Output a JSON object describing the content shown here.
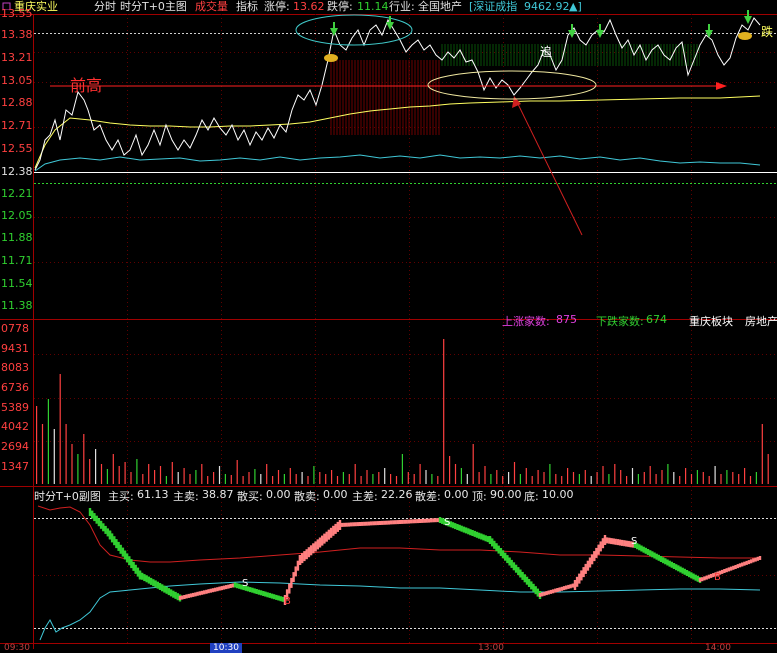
{
  "toolbar": {
    "stock_name": "重庆实业",
    "tab_timeshare": "分时",
    "tab_t0_main": "时分T+0主图",
    "tab_volume": "成交量",
    "tab_indicator": "指标",
    "limit_up_label": "涨停:",
    "limit_up_value": "13.62",
    "limit_down_label": "跌停:",
    "limit_down_value": "11.14",
    "industry_label": "行业:",
    "industry_value": "全国地产",
    "index_label": "[深证成指",
    "index_value": "9462.92",
    "index_arrow": "▲]"
  },
  "price_axis": [
    "13.55",
    "13.38",
    "13.21",
    "13.05",
    "12.88",
    "12.71",
    "12.55",
    "12.38",
    "12.21",
    "12.05",
    "11.88",
    "11.71",
    "11.54",
    "11.38"
  ],
  "volume_axis": [
    "0778",
    "9431",
    "8083",
    "6736",
    "5389",
    "4042",
    "2694",
    "1347"
  ],
  "annotations": {
    "previous_high": "前高",
    "chase": "追",
    "fall": "跌",
    "s_label_1": "S",
    "s_label_2": "S",
    "s_label_3": "S",
    "b_label_1": "B",
    "b_label_2": "B"
  },
  "breadth": {
    "up_label": "上涨家数:",
    "up_value": "875",
    "down_label": "下跌家数:",
    "down_value": "674",
    "sector": "重庆板块",
    "category": "房地产"
  },
  "sub_chart": {
    "title": "时分T+0副图",
    "main_buy_label": "主买:",
    "main_buy_value": "61.13",
    "main_sell_label": "主卖:",
    "main_sell_value": "38.87",
    "retail_buy_label": "散买:",
    "retail_buy_value": "0.00",
    "retail_sell_label": "散卖:",
    "retail_sell_value": "0.00",
    "main_diff_label": "主差:",
    "main_diff_value": "22.26",
    "retail_diff_label": "散差:",
    "retail_diff_value": "0.00",
    "top_label": "顶:",
    "top_value": "90.00",
    "bottom_label": "底:",
    "bottom_value": "10.00"
  },
  "time_axis": {
    "t1": "09:30",
    "t2": "10:30",
    "t3": "13:00",
    "t4": "14:00"
  },
  "colors": {
    "price_line": "#ffffff",
    "avg_line": "#ffff60",
    "index_line": "#40c8d8",
    "up": "#ff4040",
    "down": "#30d030",
    "magenta": "#e040e0"
  }
}
